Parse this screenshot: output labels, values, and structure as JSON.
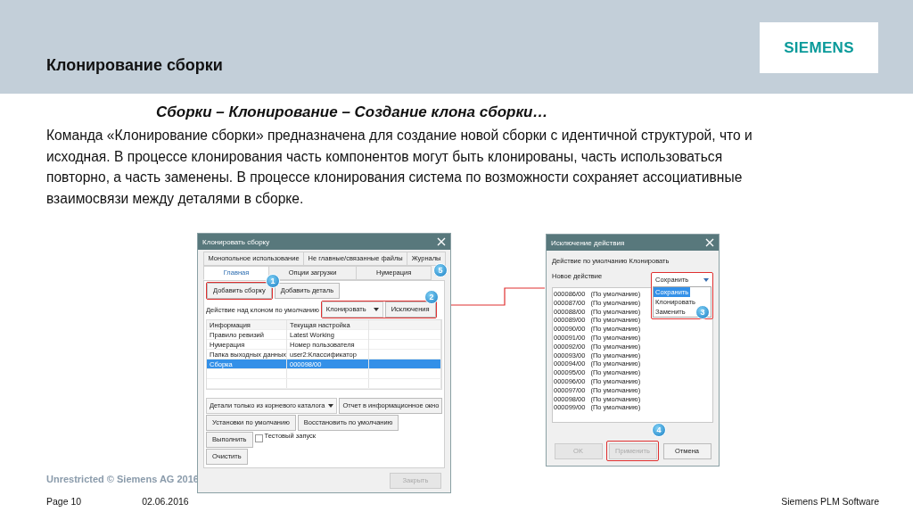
{
  "slide": {
    "title": "Клонирование сборки",
    "logo": "SIEMENS",
    "subtitle": "Сборки – Клонирование – Создание клона сборки…",
    "paragraph": "Команда «Клонирование сборки» предназначена для создание новой сборки с идентичной структурой, что и исходная. В процессе клонирования часть компонентов могут быть клонированы, часть использоваться повторно, а часть заменены. В процессе клонирования система по возможности сохраняет ассоциативные взаимосвязи между деталями в сборке."
  },
  "clone_dialog": {
    "title": "Клонировать сборку",
    "tabs_row1": [
      {
        "label": "Монопольное использование",
        "selected": false
      },
      {
        "label": "Не главные/связанные файлы",
        "selected": false
      },
      {
        "label": "Журналы",
        "selected": false
      }
    ],
    "tabs_row2": [
      {
        "label": "Главная",
        "selected": true
      },
      {
        "label": "Опции загрузки",
        "selected": false
      },
      {
        "label": "Нумерация",
        "selected": false
      }
    ],
    "add_buttons": [
      "Добавить сборку",
      "Добавить деталь"
    ],
    "default_action_label": "Действие над клоном по умолчанию",
    "default_action_value": "Клонировать",
    "exceptions_button": "Исключения",
    "table": {
      "columns": [
        "Информация",
        "Текущая настройка"
      ],
      "rows": [
        {
          "cells": [
            "Правило ревизий",
            "Latest Working"
          ],
          "selected": false
        },
        {
          "cells": [
            "Нумерация",
            "Номер пользователя"
          ],
          "selected": false
        },
        {
          "cells": [
            "Папка выходных данных",
            "user2:Классификатор"
          ],
          "selected": false
        },
        {
          "cells": [
            "Сборка",
            "000098/00"
          ],
          "selected": true
        }
      ]
    },
    "filter_dropdown": "Детали только из корневого каталога",
    "report_button": "Отчет в информационное окно",
    "defaults_button": "Установки по умолчанию",
    "restore_button": "Восстановить по умолчанию",
    "run_button": "Выполнить",
    "test_run": {
      "label": "Тестовый запуск",
      "checked": false
    },
    "clear_button": "Очистить",
    "close_button": {
      "label": "Закрыть",
      "disabled": true
    }
  },
  "exception_dialog": {
    "title": "Исключение действия",
    "default_action": "Действие по умолчанию Клонировать",
    "new_action_label": "Новое действие",
    "new_action_value": "Сохранить",
    "options": [
      {
        "label": "Сохранить",
        "selected": true
      },
      {
        "label": "Клонировать",
        "selected": false
      },
      {
        "label": "Заменить",
        "selected": false
      }
    ],
    "items": [
      {
        "id": "000086/00",
        "status": "(По умолчанию)"
      },
      {
        "id": "000087/00",
        "status": "(По умолчанию)"
      },
      {
        "id": "000088/00",
        "status": "(По умолчанию)"
      },
      {
        "id": "000089/00",
        "status": "(По умолчанию)"
      },
      {
        "id": "000090/00",
        "status": "(По умолчанию)"
      },
      {
        "id": "000091/00",
        "status": "(По умолчанию)"
      },
      {
        "id": "000092/00",
        "status": "(По умолчанию)"
      },
      {
        "id": "000093/00",
        "status": "(По умолчанию)"
      },
      {
        "id": "000094/00",
        "status": "(По умолчанию)"
      },
      {
        "id": "000095/00",
        "status": "(По умолчанию)"
      },
      {
        "id": "000096/00",
        "status": "(По умолчанию)"
      },
      {
        "id": "000097/00",
        "status": "(По умолчанию)"
      },
      {
        "id": "000098/00",
        "status": "(По умолчанию)"
      },
      {
        "id": "000099/00",
        "status": "(По умолчанию)"
      }
    ],
    "buttons": [
      {
        "label": "OK",
        "disabled": true
      },
      {
        "label": "Применить",
        "disabled": true
      },
      {
        "label": "Отмена",
        "disabled": false
      }
    ]
  },
  "callouts": [
    "1",
    "2",
    "3",
    "4",
    "5"
  ],
  "footer": {
    "copyright": "Unrestricted © Siemens AG 2016",
    "page": "Page 10",
    "date": "02.06.2016",
    "company": "Siemens PLM Software"
  }
}
